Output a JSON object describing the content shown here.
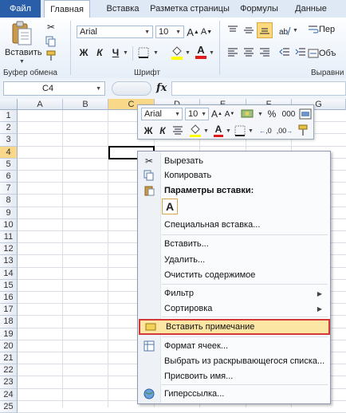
{
  "tabs": {
    "file": "Файл",
    "home": "Главная",
    "insert": "Вставка",
    "page_layout": "Разметка страницы",
    "formulas": "Формулы",
    "data": "Данные"
  },
  "ribbon": {
    "paste_label": "Вставить",
    "font_name": "Arial",
    "font_size": "10",
    "bold": "Ж",
    "italic": "К",
    "underline": "Ч",
    "grow": "A",
    "shrink": "A",
    "font_color_letter": "A",
    "groups": {
      "clipboard": "Буфер обмена",
      "font": "Шрифт",
      "alignment": "Выравни"
    },
    "wrap_partial": "Пер",
    "merge_partial": "Объ"
  },
  "formula_bar": {
    "name_box": "C4",
    "fx": "fx"
  },
  "grid": {
    "columns": [
      "A",
      "B",
      "C",
      "D",
      "E",
      "F",
      "G"
    ],
    "rows": [
      "1",
      "2",
      "3",
      "4",
      "5",
      "6",
      "7",
      "8",
      "9",
      "10",
      "11",
      "12",
      "13",
      "14",
      "15",
      "16",
      "17",
      "18",
      "19",
      "20",
      "21",
      "22",
      "23",
      "24",
      "25"
    ]
  },
  "mini_toolbar": {
    "font_name": "Arial",
    "font_size": "10",
    "bold": "Ж",
    "italic": "К",
    "percent": "%",
    "thousands": "000",
    "dec_inc": ",0",
    "dec_dec": ",00"
  },
  "context_menu": {
    "cut": "Вырезать",
    "copy": "Копировать",
    "paste_options": "Параметры вставки:",
    "paste_letter": "A",
    "paste_special": "Специальная вставка...",
    "insert": "Вставить...",
    "delete": "Удалить...",
    "clear": "Очистить содержимое",
    "filter": "Фильтр",
    "sort": "Сортировка",
    "insert_comment": "Вставить примечание",
    "format_cells": "Формат ячеек...",
    "pick_from_list": "Выбрать из раскрывающегося списка...",
    "define_name": "Присвоить имя...",
    "hyperlink": "Гиперссылка..."
  },
  "colors": {
    "file_tab": "#2a5ea8",
    "selected_header": "#f9d889",
    "highlight_border": "#d23a3a",
    "highlight_fill": "#fce6a4"
  }
}
